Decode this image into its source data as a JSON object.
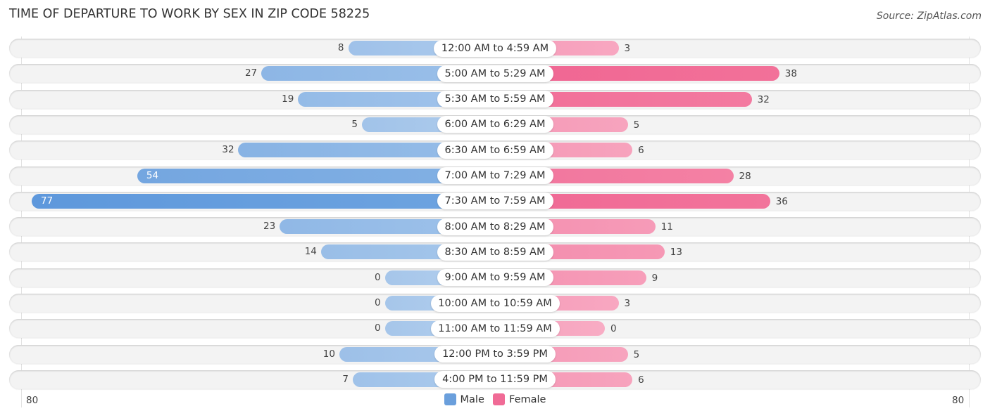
{
  "chart_data": {
    "type": "bar",
    "orientation": "horizontal-diverging",
    "title": "TIME OF DEPARTURE TO WORK BY SEX IN ZIP CODE 58225",
    "source": "Source: ZipAtlas.com",
    "categories": [
      "12:00 AM to 4:59 AM",
      "5:00 AM to 5:29 AM",
      "5:30 AM to 5:59 AM",
      "6:00 AM to 6:29 AM",
      "6:30 AM to 6:59 AM",
      "7:00 AM to 7:29 AM",
      "7:30 AM to 7:59 AM",
      "8:00 AM to 8:29 AM",
      "8:30 AM to 8:59 AM",
      "9:00 AM to 9:59 AM",
      "10:00 AM to 10:59 AM",
      "11:00 AM to 11:59 AM",
      "12:00 PM to 3:59 PM",
      "4:00 PM to 11:59 PM"
    ],
    "series": [
      {
        "name": "Male",
        "color": "#6a9fdc",
        "values": [
          8,
          27,
          19,
          5,
          32,
          54,
          77,
          23,
          14,
          0,
          0,
          0,
          10,
          7
        ]
      },
      {
        "name": "Female",
        "color": "#f06b96",
        "values": [
          3,
          38,
          32,
          5,
          6,
          28,
          36,
          11,
          13,
          9,
          3,
          0,
          5,
          6
        ]
      }
    ],
    "axis": {
      "left_label": "80",
      "right_label": "80",
      "range": [
        0,
        80
      ]
    },
    "legend": {
      "position": "bottom-center",
      "items": [
        "Male",
        "Female"
      ]
    },
    "grid": false
  }
}
